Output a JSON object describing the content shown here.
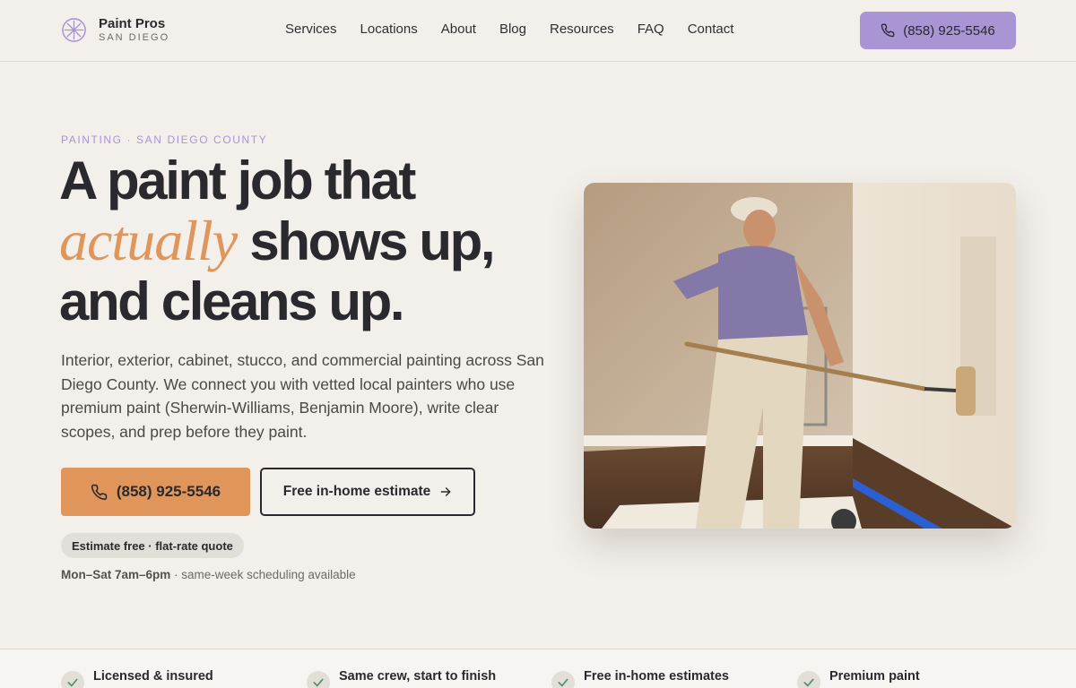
{
  "brand": {
    "name": "Paint Pros",
    "sub": "SAN DIEGO"
  },
  "nav": [
    "Services",
    "Locations",
    "About",
    "Blog",
    "Resources",
    "FAQ",
    "Contact"
  ],
  "header_phone": "(858) 925-5546",
  "hero": {
    "eyebrow": "PAINTING · SAN DIEGO COUNTY",
    "h1_line1": "A paint job that",
    "h1_accent": "actually",
    "h1_line2_rest": " shows up,",
    "h1_line3": "and cleans up.",
    "lede": "Interior, exterior, cabinet, stucco, and commercial painting across San Diego County. We connect you with vetted local painters who use premium paint (Sherwin-Williams, Benjamin Moore), write clear scopes, and prep before they paint.",
    "call_label": "(858) 925-5546",
    "estimate_label": "Free in-home estimate",
    "pill": "Estimate free · flat-rate quote",
    "hours_bold": "Mon–Sat 7am–6pm",
    "hours_rest": " · same-week scheduling available"
  },
  "features": [
    "Licensed & insured",
    "Same crew, start to finish",
    "Free in-home estimates",
    "Premium paint"
  ],
  "colors": {
    "accent_orange": "#e0965a",
    "accent_purple": "#a994d4",
    "ink": "#2a2a2e",
    "bg": "#f3f0eb"
  },
  "icons": {
    "phone": "phone-icon",
    "arrow": "arrow-right-icon",
    "check": "check-icon",
    "logo": "compass-star-icon"
  }
}
